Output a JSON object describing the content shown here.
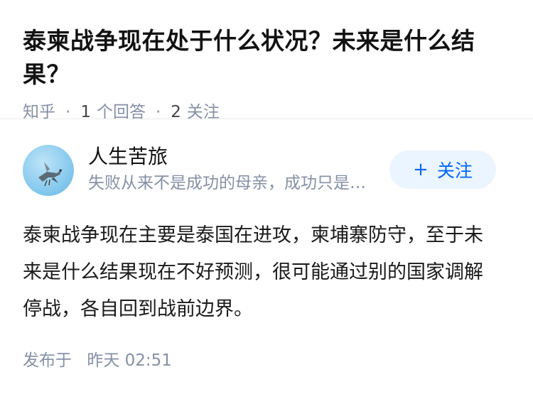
{
  "question": {
    "title": "泰柬战争现在处于什么状况？未来是什么结果？",
    "source": "知乎",
    "answer_count": "1",
    "answer_label": "个回答",
    "follow_count": "2",
    "follow_label": "关注"
  },
  "answer": {
    "author_name": "人生苦旅",
    "author_headline": "失败从来不是成功的母亲，成功只是失败的转化",
    "avatar_icon": "bird-avatar-icon",
    "follow_button": {
      "icon": "plus-icon",
      "icon_glyph": "+",
      "label": "关注"
    },
    "content": "泰柬战争现在主要是泰国在进攻，柬埔寨防守，至于未来是什么结果现在不好预测，很可能通过别的国家调解停战，各自回到战前边界。",
    "published_label": "发布于",
    "published_time": "昨天 02:51"
  },
  "colors": {
    "meta_gray": "#8590a6",
    "follow_bg": "#ebf5ff",
    "follow_text": "#0066ff",
    "title_text": "#121212"
  }
}
